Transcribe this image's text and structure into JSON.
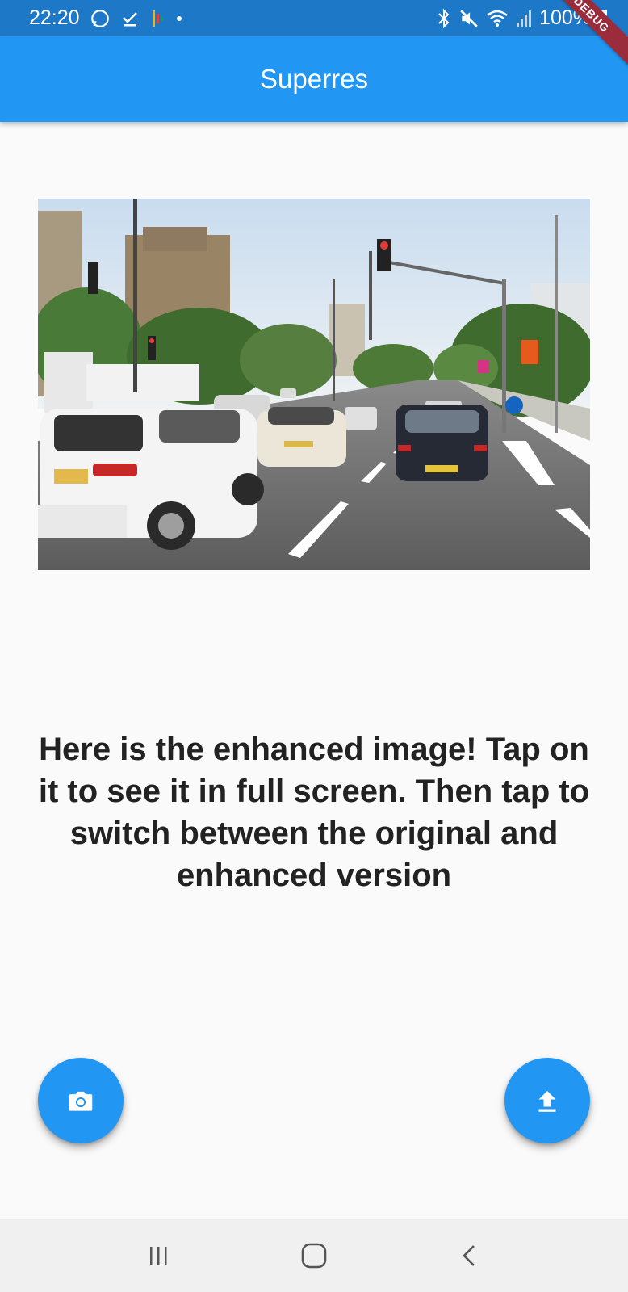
{
  "status_bar": {
    "time": "22:20",
    "battery": "100%",
    "left_icons": [
      "whatsapp-icon",
      "download-done-icon",
      "app-icon",
      "dot-icon"
    ],
    "right_icons": [
      "bluetooth-icon",
      "mute-icon",
      "wifi-icon",
      "signal-icon",
      "battery-icon"
    ]
  },
  "debug_banner": "DEBUG",
  "app_bar": {
    "title": "Superres"
  },
  "image": {
    "description_icon": "street-photo",
    "colors": {
      "sky": "#dfe9f2",
      "road": "#6b6b6b",
      "trees": "#3f6b2f"
    }
  },
  "message": "Here is the enhanced image! Tap on it to see it in full screen. Then tap to switch between the original and enhanced version",
  "fabs": {
    "camera": {
      "icon": "camera-icon"
    },
    "upload": {
      "icon": "upload-icon"
    }
  },
  "nav_bar": {
    "buttons": [
      "recents-icon",
      "home-icon",
      "back-icon"
    ]
  },
  "colors": {
    "status_bar": "#1e78c8",
    "app_bar": "#2196f3",
    "fab": "#2196f3",
    "background": "#fafafa",
    "debug": "#9b2c3b"
  }
}
